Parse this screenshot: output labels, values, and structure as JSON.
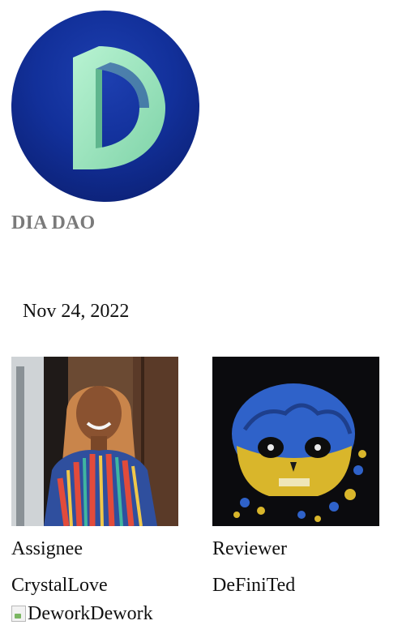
{
  "organization": {
    "name": "DIA DAO",
    "logo_icon": "dia-d-logo-icon"
  },
  "task": {
    "date": "Nov 24, 2022"
  },
  "people": {
    "assignee": {
      "role_label": "Assignee",
      "name": "CrystalLove",
      "avatar_icon": "person-photo-avatar"
    },
    "reviewer": {
      "role_label": "Reviewer",
      "name": "DeFiniTed",
      "avatar_icon": "blue-yellow-skull-avatar"
    }
  },
  "footer": {
    "dework_text": "DeworkDework",
    "dework_icon": "broken-image-icon"
  },
  "colors": {
    "logo_bg": "#12309a",
    "logo_d": "#9fe6c0",
    "org_name": "#7a7a7a",
    "text": "#111111"
  }
}
